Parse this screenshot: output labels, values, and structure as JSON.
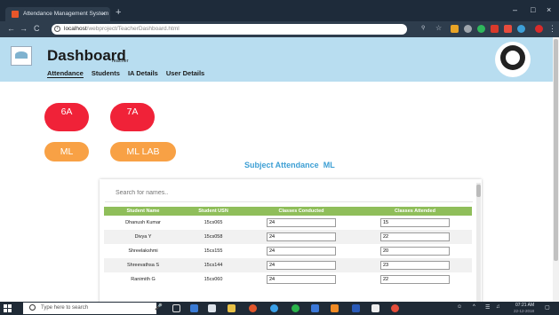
{
  "browser": {
    "tab_title": "Attendance Management System",
    "tab_close": "×",
    "new_tab": "+",
    "url_host": "localhost",
    "url_path": "/webproject/TeacherDashboard.html",
    "window_controls": [
      "–",
      "□",
      "×"
    ],
    "nav_icons": [
      "←",
      "→",
      "C"
    ]
  },
  "header": {
    "title": "Dashboard",
    "role": "Teacher",
    "nav": [
      "Attendance",
      "Students",
      "IA Details",
      "User Details"
    ],
    "active_nav": "Attendance"
  },
  "classes": [
    "6A",
    "7A"
  ],
  "subjects": [
    "ML",
    "ML LAB"
  ],
  "section": {
    "label": "Subject Attendance",
    "subject": "ML"
  },
  "search": {
    "placeholder": "Search for names.."
  },
  "table": {
    "headers": [
      "Student Name",
      "Student USN",
      "Classes Conducted",
      "Classes Attended"
    ],
    "rows": [
      {
        "name": "Dhanush Kumar",
        "usn": "15cs065",
        "conducted": "24",
        "attended": "15"
      },
      {
        "name": "Divya Y",
        "usn": "15cs058",
        "conducted": "24",
        "attended": "22"
      },
      {
        "name": "Shreelakshmi",
        "usn": "15cs155",
        "conducted": "24",
        "attended": "20"
      },
      {
        "name": "Shreevathsa S",
        "usn": "15cs144",
        "conducted": "24",
        "attended": "23"
      },
      {
        "name": "Ranimith G",
        "usn": "15cs060",
        "conducted": "24",
        "attended": "22"
      }
    ]
  },
  "taskbar": {
    "search_placeholder": "Type here to search",
    "time": "07:21 AM",
    "date": "22-12-2018"
  },
  "colors": {
    "header_bg": "#b8ddf0",
    "pill_red": "#f02238",
    "pill_orange": "#f8a145",
    "accent_blue": "#3d9fd4",
    "table_header": "#8fbe5a"
  }
}
